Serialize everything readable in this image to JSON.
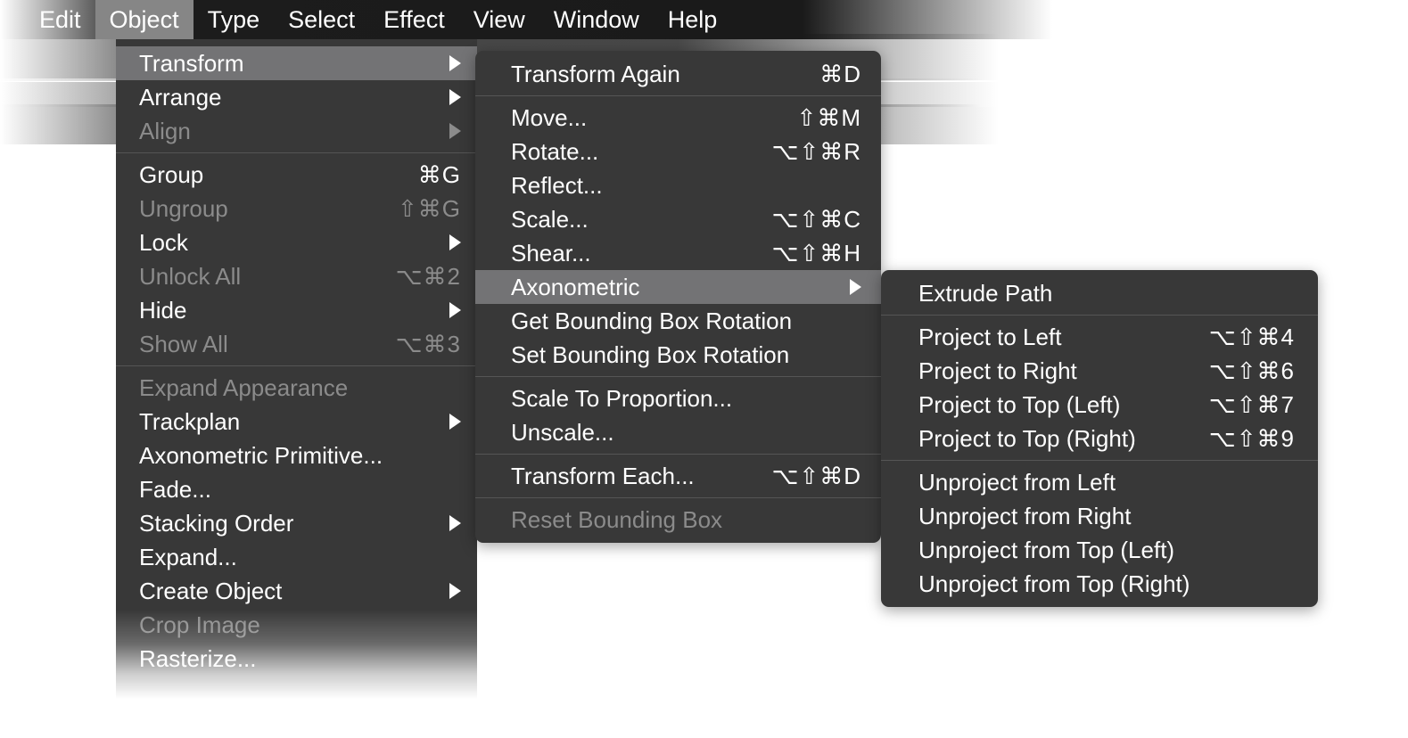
{
  "menubar": {
    "items": [
      {
        "label": "Edit",
        "active": false
      },
      {
        "label": "Object",
        "active": true
      },
      {
        "label": "Type",
        "active": false
      },
      {
        "label": "Select",
        "active": false
      },
      {
        "label": "Effect",
        "active": false
      },
      {
        "label": "View",
        "active": false
      },
      {
        "label": "Window",
        "active": false
      },
      {
        "label": "Help",
        "active": false
      }
    ]
  },
  "object_menu": {
    "groups": [
      [
        {
          "label": "Transform",
          "shortcut": "",
          "submenu": true,
          "disabled": false,
          "highlight": true
        },
        {
          "label": "Arrange",
          "shortcut": "",
          "submenu": true,
          "disabled": false,
          "highlight": false
        },
        {
          "label": "Align",
          "shortcut": "",
          "submenu": true,
          "disabled": true,
          "highlight": false
        }
      ],
      [
        {
          "label": "Group",
          "shortcut": "⌘G",
          "submenu": false,
          "disabled": false,
          "highlight": false
        },
        {
          "label": "Ungroup",
          "shortcut": "⇧⌘G",
          "submenu": false,
          "disabled": true,
          "highlight": false
        },
        {
          "label": "Lock",
          "shortcut": "",
          "submenu": true,
          "disabled": false,
          "highlight": false
        },
        {
          "label": "Unlock All",
          "shortcut": "⌥⌘2",
          "submenu": false,
          "disabled": true,
          "highlight": false
        },
        {
          "label": "Hide",
          "shortcut": "",
          "submenu": true,
          "disabled": false,
          "highlight": false
        },
        {
          "label": "Show All",
          "shortcut": "⌥⌘3",
          "submenu": false,
          "disabled": true,
          "highlight": false
        }
      ],
      [
        {
          "label": "Expand Appearance",
          "shortcut": "",
          "submenu": false,
          "disabled": true,
          "highlight": false
        },
        {
          "label": "Trackplan",
          "shortcut": "",
          "submenu": true,
          "disabled": false,
          "highlight": false
        },
        {
          "label": "Axonometric Primitive...",
          "shortcut": "",
          "submenu": false,
          "disabled": false,
          "highlight": false
        },
        {
          "label": "Fade...",
          "shortcut": "",
          "submenu": false,
          "disabled": false,
          "highlight": false
        },
        {
          "label": "Stacking Order",
          "shortcut": "",
          "submenu": true,
          "disabled": false,
          "highlight": false
        },
        {
          "label": "Expand...",
          "shortcut": "",
          "submenu": false,
          "disabled": false,
          "highlight": false
        },
        {
          "label": "Create Object",
          "shortcut": "",
          "submenu": true,
          "disabled": false,
          "highlight": false
        },
        {
          "label": "Crop Image",
          "shortcut": "",
          "submenu": false,
          "disabled": true,
          "highlight": false
        },
        {
          "label": "Rasterize...",
          "shortcut": "",
          "submenu": false,
          "disabled": false,
          "highlight": false
        }
      ]
    ]
  },
  "transform_menu": {
    "groups": [
      [
        {
          "label": "Transform Again",
          "shortcut": "⌘D",
          "submenu": false,
          "disabled": false,
          "highlight": false
        }
      ],
      [
        {
          "label": "Move...",
          "shortcut": "⇧⌘M",
          "submenu": false,
          "disabled": false,
          "highlight": false
        },
        {
          "label": "Rotate...",
          "shortcut": "⌥⇧⌘R",
          "submenu": false,
          "disabled": false,
          "highlight": false
        },
        {
          "label": "Reflect...",
          "shortcut": "",
          "submenu": false,
          "disabled": false,
          "highlight": false
        },
        {
          "label": "Scale...",
          "shortcut": "⌥⇧⌘C",
          "submenu": false,
          "disabled": false,
          "highlight": false
        },
        {
          "label": "Shear...",
          "shortcut": "⌥⇧⌘H",
          "submenu": false,
          "disabled": false,
          "highlight": false
        },
        {
          "label": "Axonometric",
          "shortcut": "",
          "submenu": true,
          "disabled": false,
          "highlight": true
        },
        {
          "label": "Get Bounding Box Rotation",
          "shortcut": "",
          "submenu": false,
          "disabled": false,
          "highlight": false
        },
        {
          "label": "Set Bounding Box Rotation",
          "shortcut": "",
          "submenu": false,
          "disabled": false,
          "highlight": false
        }
      ],
      [
        {
          "label": "Scale To Proportion...",
          "shortcut": "",
          "submenu": false,
          "disabled": false,
          "highlight": false
        },
        {
          "label": "Unscale...",
          "shortcut": "",
          "submenu": false,
          "disabled": false,
          "highlight": false
        }
      ],
      [
        {
          "label": "Transform Each...",
          "shortcut": "⌥⇧⌘D",
          "submenu": false,
          "disabled": false,
          "highlight": false
        }
      ],
      [
        {
          "label": "Reset Bounding Box",
          "shortcut": "",
          "submenu": false,
          "disabled": true,
          "highlight": false
        }
      ]
    ]
  },
  "axonometric_menu": {
    "groups": [
      [
        {
          "label": "Extrude Path",
          "shortcut": "",
          "submenu": false,
          "disabled": false,
          "highlight": false
        }
      ],
      [
        {
          "label": "Project to Left",
          "shortcut": "⌥⇧⌘4",
          "submenu": false,
          "disabled": false,
          "highlight": false
        },
        {
          "label": "Project to Right",
          "shortcut": "⌥⇧⌘6",
          "submenu": false,
          "disabled": false,
          "highlight": false
        },
        {
          "label": "Project to Top (Left)",
          "shortcut": "⌥⇧⌘7",
          "submenu": false,
          "disabled": false,
          "highlight": false
        },
        {
          "label": "Project to Top (Right)",
          "shortcut": "⌥⇧⌘9",
          "submenu": false,
          "disabled": false,
          "highlight": false
        }
      ],
      [
        {
          "label": "Unproject from Left",
          "shortcut": "",
          "submenu": false,
          "disabled": false,
          "highlight": false
        },
        {
          "label": "Unproject from Right",
          "shortcut": "",
          "submenu": false,
          "disabled": false,
          "highlight": false
        },
        {
          "label": "Unproject from Top (Left)",
          "shortcut": "",
          "submenu": false,
          "disabled": false,
          "highlight": false
        },
        {
          "label": "Unproject from Top (Right)",
          "shortcut": "",
          "submenu": false,
          "disabled": false,
          "highlight": false
        }
      ]
    ]
  },
  "colors": {
    "menu_bg": "#383838",
    "menu_highlight": "#737375",
    "menubar_bg": "#1c1c1c",
    "menubar_active": "#868686",
    "label": "#ffffff",
    "label_disabled": "#8b8b8b",
    "separator": "#555555"
  }
}
